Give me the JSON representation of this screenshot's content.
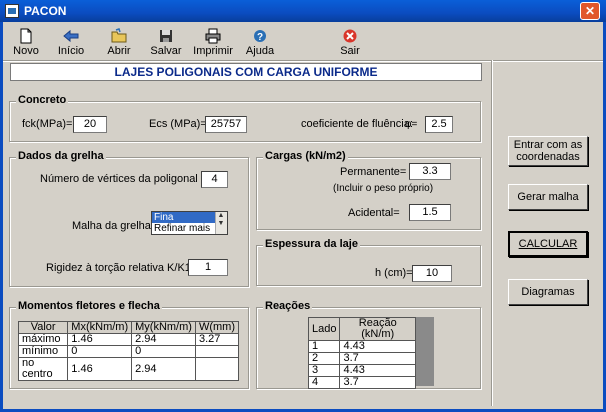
{
  "window": {
    "title": "PACON",
    "close_glyph": "✕"
  },
  "toolbar": [
    {
      "id": "novo",
      "label": "Novo",
      "icon": "new-file-icon"
    },
    {
      "id": "inicio",
      "label": "Início",
      "icon": "back-arrow-icon"
    },
    {
      "id": "abrir",
      "label": "Abrir",
      "icon": "open-folder-icon"
    },
    {
      "id": "salvar",
      "label": "Salvar",
      "icon": "floppy-disk-icon"
    },
    {
      "id": "imprimir",
      "label": "Imprimir",
      "icon": "printer-icon"
    },
    {
      "id": "ajuda",
      "label": "Ajuda",
      "icon": "help-icon"
    },
    {
      "id": "sair",
      "label": "Sair",
      "icon": "exit-icon"
    }
  ],
  "header_title": "LAJES POLIGONAIS COM CARGA UNIFORME",
  "concreto": {
    "title": "Concreto",
    "fck_label": "fck(MPa)=",
    "fck_value": "20",
    "ecs_label": "Ecs (MPa)=",
    "ecs_value": "25757",
    "fluencia_label": "coeficiente de fluência:",
    "phi_symbol": "φ=",
    "fluencia_value": "2.5"
  },
  "grelha": {
    "title": "Dados da grelha",
    "vertices_label": "Número de vértices da poligonal =",
    "vertices_value": "4",
    "malha_label": "Malha da grelha :",
    "malha_options": [
      "Fina",
      "Refinar mais"
    ],
    "rigidez_label": "Rigidez à torção relativa K/K1 =",
    "rigidez_value": "1"
  },
  "cargas": {
    "title": "Cargas (kN/m2)",
    "permanente_label": "Permanente=",
    "permanente_value": "3.3",
    "permanente_note": "(Incluir o peso próprio)",
    "acidental_label": "Acidental=",
    "acidental_value": "1.5"
  },
  "espessura": {
    "title": "Espessura da laje",
    "h_label": "h (cm)=",
    "h_value": "10"
  },
  "momentos": {
    "title": "Momentos fletores e flecha",
    "headers": [
      "Valor",
      "Mx(kNm/m)",
      "My(kNm/m)",
      "W(mm)"
    ],
    "rows": [
      [
        "máximo",
        "1.46",
        "2.94",
        "3.27"
      ],
      [
        "mínimo",
        "0",
        "0",
        ""
      ],
      [
        "no centro",
        "1.46",
        "2.94",
        ""
      ]
    ]
  },
  "reacoes": {
    "title": "Reações",
    "headers": [
      "Lado",
      "Reação (kN/m)"
    ],
    "rows": [
      [
        "1",
        "4.43"
      ],
      [
        "2",
        "3.7"
      ],
      [
        "3",
        "4.43"
      ],
      [
        "4",
        "3.7"
      ]
    ]
  },
  "buttons": {
    "entrar_line1": "Entrar com as",
    "entrar_line2": "coordenadas",
    "gerar": "Gerar malha",
    "calcular": "CALCULAR",
    "diagramas": "Diagramas"
  }
}
